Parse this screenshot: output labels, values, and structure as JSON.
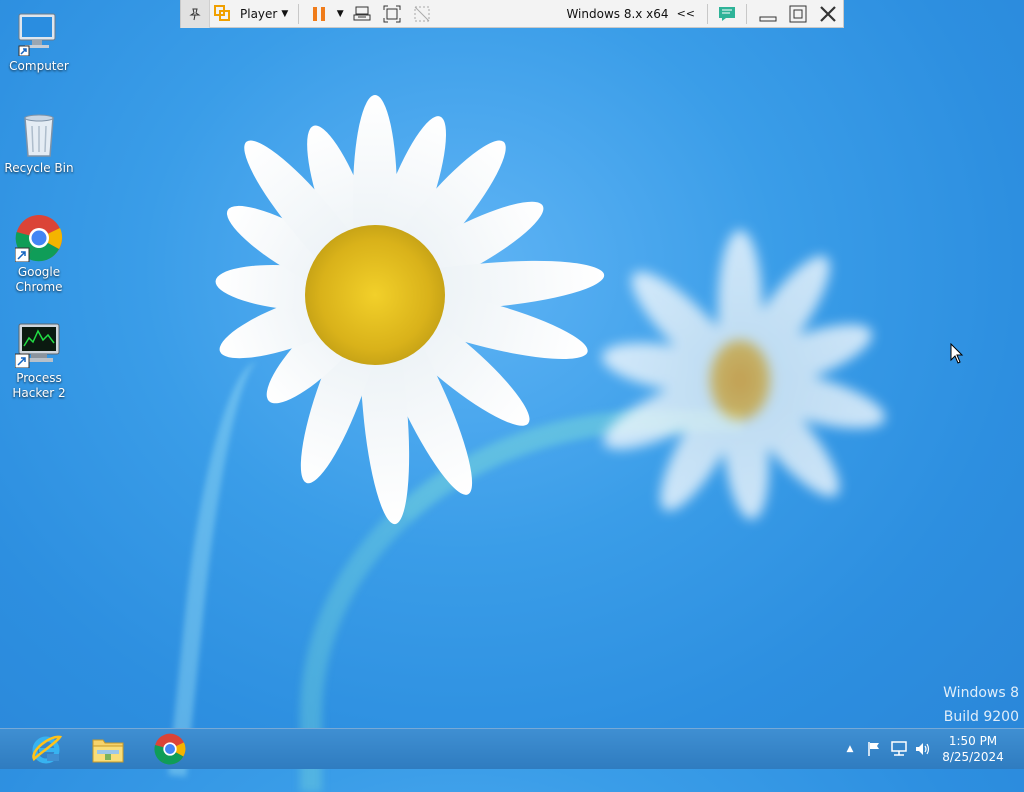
{
  "desktop": {
    "icons": [
      {
        "label": "Computer",
        "icon": "computer-icon"
      },
      {
        "label": "Recycle Bin",
        "icon": "recycle-bin-icon"
      },
      {
        "label": "Google Chrome",
        "icon": "chrome-icon"
      },
      {
        "label": "Process Hacker 2",
        "icon": "process-hacker-icon"
      }
    ],
    "watermark": {
      "line1": "Windows 8",
      "line2": "Build 9200"
    }
  },
  "vm_toolbar": {
    "player_label": "Player",
    "vm_name": "Windows 8.x x64",
    "collapse_glyph": "<<",
    "icons": [
      "pin-icon",
      "vm-logo-icon",
      "pause-icon",
      "send-ctrl-alt-del-icon",
      "fullscreen-icon",
      "unity-icon",
      "message-icon",
      "minimize-icon",
      "restore-icon",
      "close-icon"
    ],
    "accent_color": "#f07c1a"
  },
  "taskbar": {
    "apps": [
      {
        "name": "Internet Explorer",
        "icon": "ie-icon"
      },
      {
        "name": "File Explorer",
        "icon": "file-explorer-icon"
      },
      {
        "name": "Google Chrome",
        "icon": "chrome-icon"
      }
    ],
    "tray_icons": [
      "show-hidden-icons-chevron",
      "action-center-flag-icon",
      "network-icon",
      "volume-icon"
    ],
    "clock": {
      "time": "1:50 PM",
      "date": "8/25/2024"
    }
  }
}
